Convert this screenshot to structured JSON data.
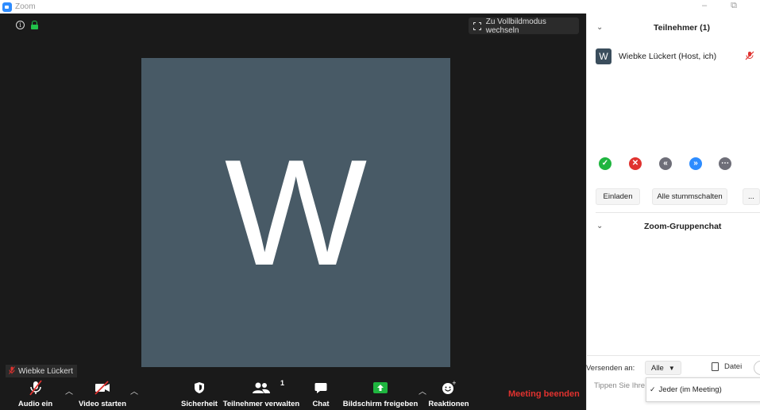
{
  "window": {
    "title": "Zoom",
    "minimize_glyph": "–",
    "restore_glyph": "⧉"
  },
  "video": {
    "fullscreen_label": "Zu Vollbildmodus wechseln",
    "avatar_letter": "W",
    "name_tag": "Wiebke Lückert",
    "avatar_color": "#485a66"
  },
  "toolbar": {
    "audio_label": "Audio ein",
    "video_label": "Video starten",
    "security_label": "Sicherheit",
    "participants_label": "Teilnehmer verwalten",
    "participants_count": "1",
    "chat_label": "Chat",
    "share_label": "Bildschirm freigeben",
    "reactions_label": "Reaktionen",
    "end_label": "Meeting beenden",
    "end_color": "#e0322f",
    "share_color": "#1fb53f"
  },
  "participants_panel": {
    "title": "Teilnehmer (1)",
    "participant": {
      "avatar_letter": "W",
      "name": "Wiebke Lückert (Host, ich)"
    },
    "invite_label": "Einladen",
    "mute_all_label": "Alle stummschalten",
    "more_label": "...",
    "reactions": [
      {
        "name": "yes",
        "glyph": "✓",
        "color": "#1fb53f"
      },
      {
        "name": "no",
        "glyph": "✕",
        "color": "#e0322f"
      },
      {
        "name": "slower",
        "glyph": "«",
        "color": "#6e6e78"
      },
      {
        "name": "faster",
        "glyph": "»",
        "color": "#2d8cff"
      },
      {
        "name": "more",
        "glyph": "⋯",
        "color": "#6e6e78"
      }
    ]
  },
  "chat_panel": {
    "title": "Zoom-Gruppenchat",
    "send_to_label": "Versenden an:",
    "send_to_value": "Alle",
    "file_label": "Datei",
    "input_placeholder": "Tippen Sie Ihre",
    "dropdown_option": "Jeder (im Meeting)"
  }
}
